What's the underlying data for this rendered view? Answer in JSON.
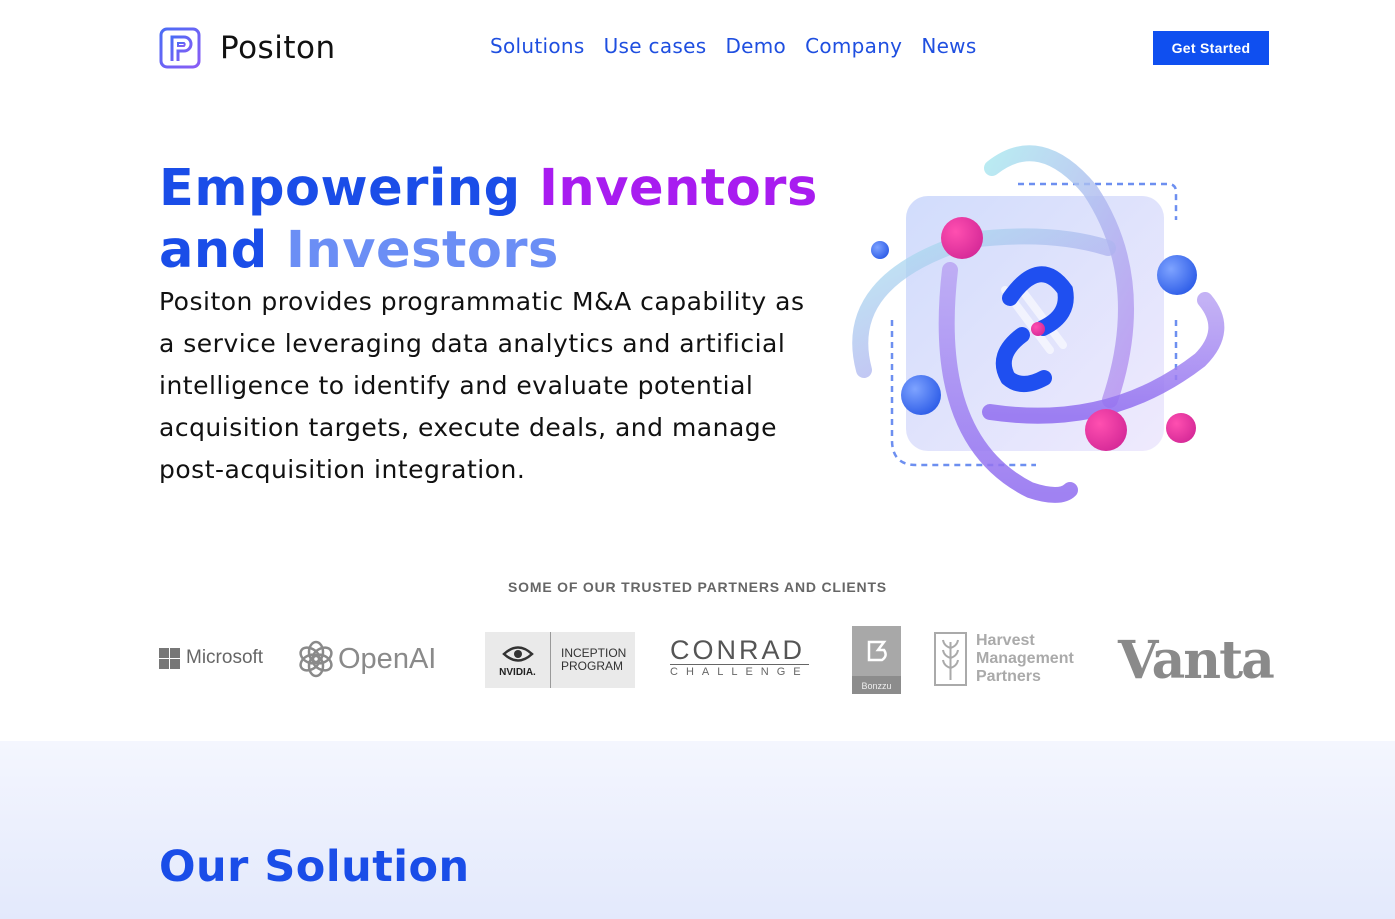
{
  "header": {
    "logo_text": "Positon",
    "nav": [
      "Solutions",
      "Use cases",
      "Demo",
      "Company",
      "News"
    ],
    "cta_label": "Get Started"
  },
  "hero": {
    "title_part1": "Empowering",
    "title_part2": "Inventors",
    "title_part3": "and",
    "title_part4": "Investors",
    "description": "Positon provides programmatic M&A capability as a service leveraging data analytics and artificial intelligence to identify and evaluate potential acquisition targets, execute deals, and manage post-acquisition integration."
  },
  "partners": {
    "title": "SOME OF OUR TRUSTED PARTNERS AND CLIENTS",
    "microsoft": "Microsoft",
    "openai": "OpenAI",
    "nvidia_word": "NVIDIA.",
    "nvidia_line1": "INCEPTION",
    "nvidia_line2": "PROGRAM",
    "conrad_big": "CONRAD",
    "conrad_small": "CHALLENGE",
    "bonzzu": "Bonzzu",
    "harvest_line1": "Harvest",
    "harvest_line2": "Management",
    "harvest_line3": "Partners",
    "vanta": "Vanta"
  },
  "solution": {
    "title": "Our Solution"
  },
  "colors": {
    "brand_blue": "#1a4de8",
    "brand_purple": "#a81cf0",
    "light_blue": "#6b8ef5",
    "cta_blue": "#0f4ff0"
  }
}
